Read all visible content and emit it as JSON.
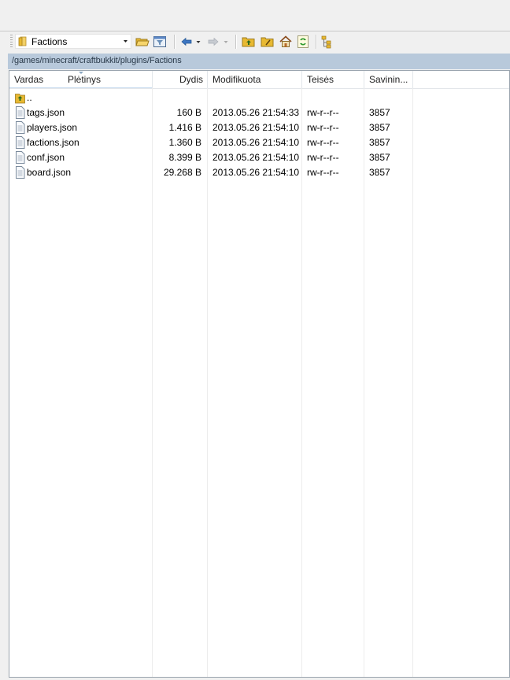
{
  "toolbar": {
    "current_folder": "Factions"
  },
  "path": "/games/minecraft/craftbukkit/plugins/Factions",
  "columns": {
    "name": "Vardas",
    "ext": "Plėtinys",
    "size": "Dydis",
    "modified": "Modifikuota",
    "rights": "Teisės",
    "owner": "Savinin..."
  },
  "parent_label": "..",
  "files": [
    {
      "name": "tags.json",
      "size": "160 B",
      "modified": "2013.05.26 21:54:33",
      "rights": "rw-r--r--",
      "owner": "3857"
    },
    {
      "name": "players.json",
      "size": "1.416 B",
      "modified": "2013.05.26 21:54:10",
      "rights": "rw-r--r--",
      "owner": "3857"
    },
    {
      "name": "factions.json",
      "size": "1.360 B",
      "modified": "2013.05.26 21:54:10",
      "rights": "rw-r--r--",
      "owner": "3857"
    },
    {
      "name": "conf.json",
      "size": "8.399 B",
      "modified": "2013.05.26 21:54:10",
      "rights": "rw-r--r--",
      "owner": "3857"
    },
    {
      "name": "board.json",
      "size": "29.268 B",
      "modified": "2013.05.26 21:54:10",
      "rights": "rw-r--r--",
      "owner": "3857"
    }
  ],
  "icons": {
    "folder_combo": "folder-icon",
    "buttons": [
      "open-folder-icon",
      "filter-icon",
      "back-icon",
      "back-dropdown-icon",
      "forward-icon",
      "forward-dropdown-icon",
      "parent-folder-icon",
      "root-folder-icon",
      "home-icon",
      "refresh-icon",
      "tree-view-icon"
    ],
    "parent_row": "up-folder-icon",
    "file": "file-icon"
  },
  "colors": {
    "path_bar": "#b8c9db",
    "folder": "#e8b932"
  }
}
